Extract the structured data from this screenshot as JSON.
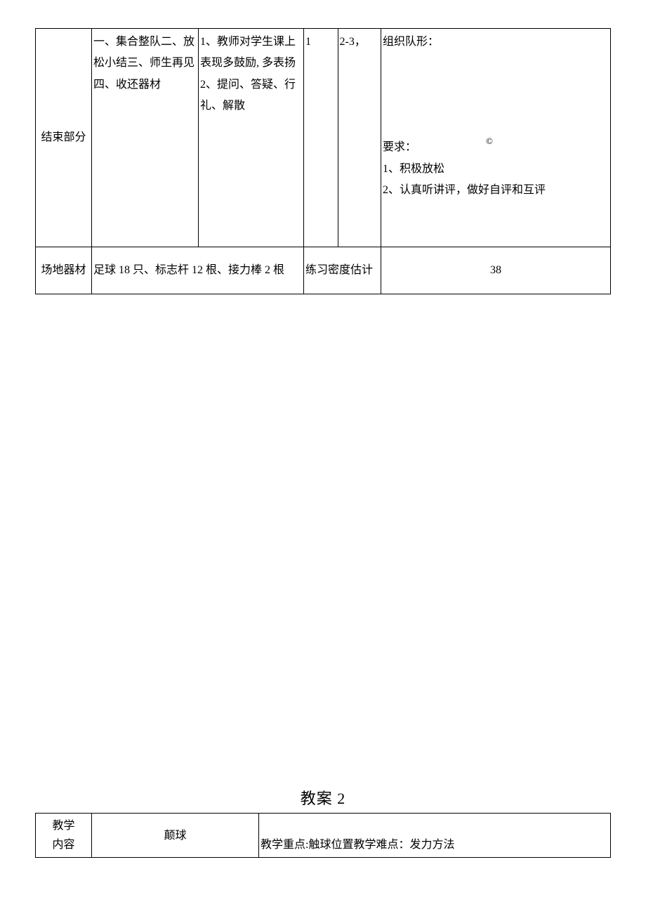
{
  "table1": {
    "row1": {
      "phase": "结束部分",
      "content": "一、集合整队二、放松小结三、师生再见四、收还器材",
      "guidance_line1": "1、教师对学生课上表现多鼓励, 多表扬",
      "guidance_line2": "2、提问、答疑、行礼、解散",
      "count": "1",
      "time": "2-3，",
      "org_label": "组织队形：",
      "req_label": "要求：",
      "req1": "1、积极放松",
      "req2": "2、认真听讲评，做好自评和互评"
    },
    "row2": {
      "equip_label": "场地器材",
      "equip_value": "足球 18 只、标志杆 12 根、接力棒 2 根",
      "density_label": "练习密度估计",
      "density_value": "38"
    }
  },
  "title2": "教案 2",
  "table2": {
    "label_line1": "教学",
    "label_line2": "内容",
    "topic": "颠球",
    "keypoint": "教学重点:触球位置教学难点：发力方法"
  },
  "copyright": "©"
}
